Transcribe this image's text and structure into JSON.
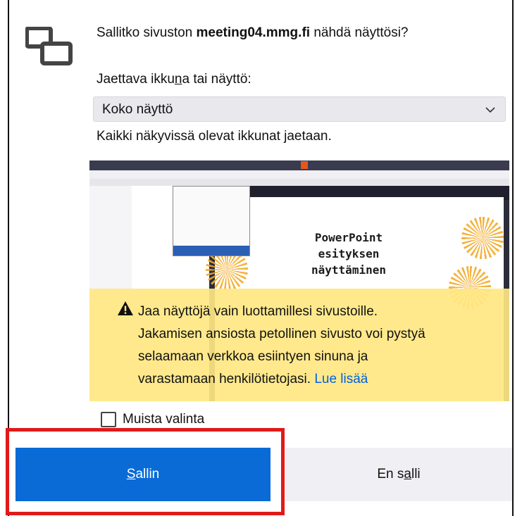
{
  "prompt": {
    "title_prefix": "Sallitko sivuston ",
    "site": "meeting04.mmg.fi",
    "title_suffix": " nähdä näyttösi?",
    "share_label_pre": "Jaettava ikku",
    "share_label_accesskey": "n",
    "share_label_post": "a tai näyttö:",
    "selected_option": "Koko näyttö",
    "description": "Kaikki näkyvissä olevat ikkunat jaetaan."
  },
  "preview": {
    "slide_text_line1": "PowerPoint",
    "slide_text_line2": "esityksen",
    "slide_text_line3": "näyttäminen"
  },
  "warning": {
    "line1": "Jaa näyttöjä vain luottamillesi sivustoille.",
    "line2": "Jakamisen ansiosta petollinen sivusto voi pystyä",
    "line3": "selaamaan verkkoa esiintyen sinuna ja",
    "line4": "varastamaan henkilötietojasi.",
    "learn_more": "Lue lisää"
  },
  "remember": {
    "label": "Muista valinta",
    "checked": false
  },
  "buttons": {
    "allow_accesskey": "S",
    "allow_rest": "allin",
    "deny_pre": "En s",
    "deny_accesskey": "a",
    "deny_post": "lli"
  },
  "colors": {
    "allow_button": "#0a6bd6",
    "warning_bg": "#ffe782",
    "highlight_border": "#e01a1a",
    "link": "#0060df"
  }
}
